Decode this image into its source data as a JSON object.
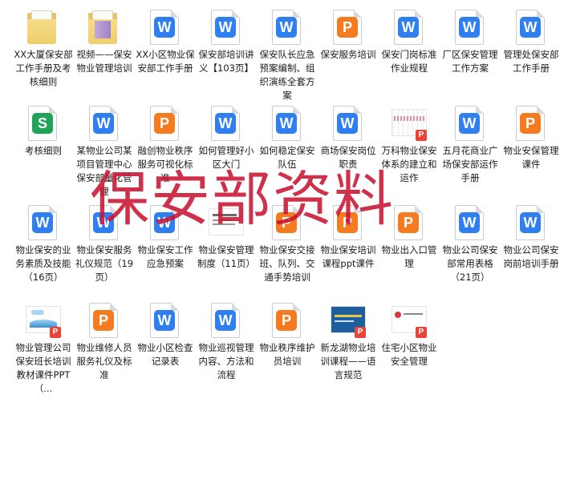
{
  "files": [
    {
      "label": "XX大厦保安部工作手册及考核细则",
      "icon": "folder-icon"
    },
    {
      "label": "视频——保安物业管理培训",
      "icon": "video-folder-icon"
    },
    {
      "label": "XX小区物业保安部工作手册",
      "icon": "word-icon"
    },
    {
      "label": "保安部培训讲义【103页】",
      "icon": "word-icon"
    },
    {
      "label": "保安队长应急预案编制、组织演练全套方案",
      "icon": "word-icon"
    },
    {
      "label": "保安服务培训",
      "icon": "ppt-icon"
    },
    {
      "label": "保安门岗标准作业规程",
      "icon": "word-icon"
    },
    {
      "label": "厂区保安管理工作方案",
      "icon": "word-icon"
    },
    {
      "label": "管理处保安部工作手册",
      "icon": "word-icon"
    },
    {
      "label": "考核细则",
      "icon": "sheet-icon"
    },
    {
      "label": "某物业公司某项目管理中心保安部量化管理",
      "icon": "word-icon"
    },
    {
      "label": "融创物业秩序服务可视化标准",
      "icon": "ppt-icon"
    },
    {
      "label": "如何管理好小区大门",
      "icon": "word-icon"
    },
    {
      "label": "如何稳定保安队伍",
      "icon": "word-icon"
    },
    {
      "label": "商场保安岗位职责",
      "icon": "word-icon"
    },
    {
      "label": "万科物业保安体系的建立和运作",
      "icon": "pdf-thumb-icon"
    },
    {
      "label": "五月花商业广场保安部运作手册",
      "icon": "word-icon"
    },
    {
      "label": "物业安保管理课件",
      "icon": "ppt-icon"
    },
    {
      "label": "物业保安的业务素质及技能（16页）",
      "icon": "word-icon"
    },
    {
      "label": "物业保安服务礼仪规范（19页）",
      "icon": "word-icon"
    },
    {
      "label": "物业保安工作应急预案",
      "icon": "word-icon"
    },
    {
      "label": "物业保安管理制度（11页）",
      "icon": "doc-thumb-icon"
    },
    {
      "label": "物业保安交接班、队列、交通手势培训",
      "icon": "ppt-icon"
    },
    {
      "label": "物业保安培训课程ppt课件",
      "icon": "ppt-icon"
    },
    {
      "label": "物业出入口管理",
      "icon": "ppt-icon"
    },
    {
      "label": "物业公司保安部常用表格（21页）",
      "icon": "word-icon"
    },
    {
      "label": "物业公司保安岗前培训手册",
      "icon": "word-icon"
    },
    {
      "label": "物业管理公司保安班长培训教材课件PPT（...",
      "icon": "pdf-thumb-icon"
    },
    {
      "label": "物业维修人员服务礼仪及标准",
      "icon": "ppt-icon"
    },
    {
      "label": "物业小区检查记录表",
      "icon": "word-icon"
    },
    {
      "label": "物业巡视管理内容、方法和流程",
      "icon": "word-icon"
    },
    {
      "label": "物业秩序维护员培训",
      "icon": "ppt-icon"
    },
    {
      "label": "新龙湖物业培训课程——语言规范",
      "icon": "pdf-thumb-icon"
    },
    {
      "label": "住宅小区物业安全管理",
      "icon": "pdf-thumb-icon"
    }
  ],
  "overlay": {
    "title": "保安部资料"
  }
}
